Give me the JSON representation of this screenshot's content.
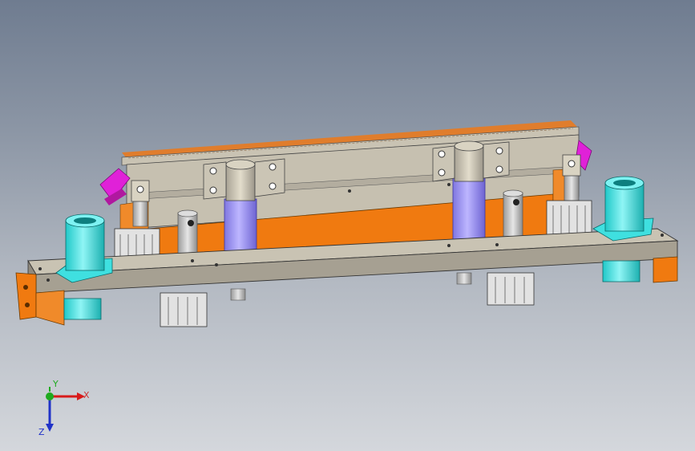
{
  "viewport": {
    "background_top": "#6f7c90",
    "background_bottom": "#d4d7dc"
  },
  "model": {
    "colors": {
      "plate": "#c9c3b3",
      "plate_shade": "#9f9a8c",
      "orange": "#f07a10",
      "cylinder_blue": "#9f97ee",
      "bearing_cyan": "#3fe0e0",
      "magenta": "#e021d8",
      "steel": "#c7c7c7"
    }
  },
  "triad": {
    "x_label": "X",
    "y_label": "Y",
    "z_label": "Z",
    "x_color": "#d81b1b",
    "y_color": "#1faa1f",
    "z_color": "#2032c8"
  }
}
